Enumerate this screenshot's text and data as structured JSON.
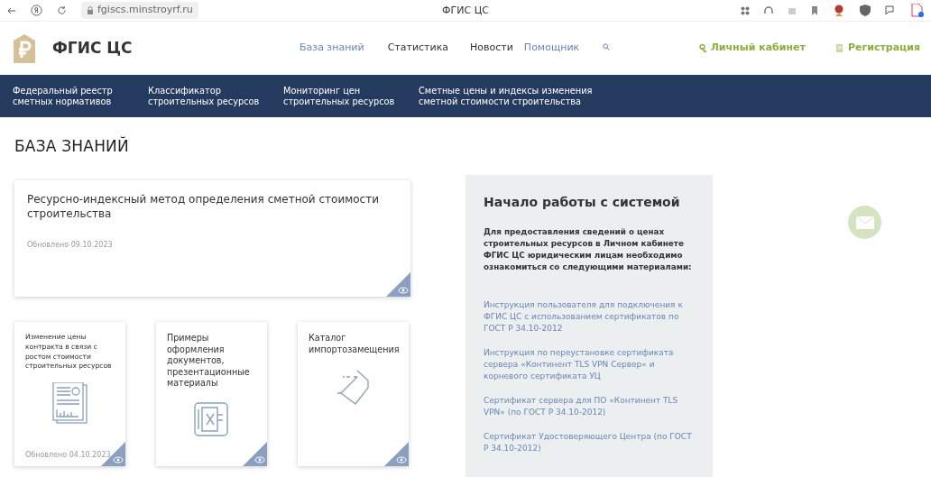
{
  "browser": {
    "url": "fgiscs.minstroyrf.ru",
    "tab_title": "ФГИС ЦС"
  },
  "header": {
    "logo_text": "ФГИС ЦС",
    "nav": [
      {
        "label": "База знаний",
        "highlighted": true
      },
      {
        "label": "Статистика",
        "highlighted": false
      },
      {
        "label": "Новости",
        "highlighted": false
      },
      {
        "label": "Помощник",
        "highlighted": true
      }
    ],
    "account": [
      {
        "label": "Личный кабинет",
        "kind": "key"
      },
      {
        "label": "Регистрация",
        "kind": "form"
      }
    ]
  },
  "menu": [
    {
      "label": "Федеральный реестр сметных нормативов"
    },
    {
      "label": "Классификатор строительных ресурсов"
    },
    {
      "label": "Мониторинг цен строительных ресурсов"
    },
    {
      "label": "Сметные цены и индексы изменения сметной стоимости строительства"
    }
  ],
  "page_title": "БАЗА ЗНАНИЙ",
  "featured": {
    "title": "Ресурсно-индексный метод определения сметной стоимости строительства",
    "updated": "Обновлено 09.10.2023"
  },
  "cards": [
    {
      "title": "Изменение цены контракта в связи с ростом стоимости строительных ресурсов",
      "updated": "Обновлено 04.10.2023",
      "kind": "report"
    },
    {
      "title": "Примеры оформления документов, презентационные материалы",
      "kind": "spreadsheet"
    },
    {
      "title": "Каталог импортозамещения",
      "kind": "tag"
    }
  ],
  "panel": {
    "title": "Начало работы с системой",
    "intro": "Для предоставления сведений о ценах строительных ресурсов в Личном кабинете ФГИС ЦС юридическим лицам необходимо ознакомиться со следующими материалами:",
    "links": [
      "Инструкция пользователя для подключения к ФГИС ЦС с использованием сертификатов по ГОСТ Р 34.10-2012",
      "Инструкция по переустановке сертификата сервера «Континент TLS VPN Сервер» и корневого сертификата УЦ",
      "Сертификат сервера для ПО «Континент TLS VPN» (по ГОСТ Р 34.10-2012)",
      "Сертификат Удостоверяющего Центра (по ГОСТ Р 34.10-2012)"
    ]
  }
}
